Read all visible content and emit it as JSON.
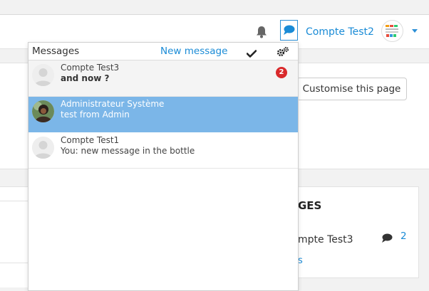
{
  "navbar": {
    "user_name": "Compte Test2",
    "icons": [
      "bell-icon",
      "chat-icon",
      "chevron-down-icon"
    ],
    "accent_color": "#1a8bd6"
  },
  "page": {
    "customise_label": "Customise this page",
    "messages_block": {
      "title_fragment": "GES",
      "contact_fragment": "mpte Test3",
      "count": "2",
      "link_fragment": "s"
    }
  },
  "popover": {
    "title": "Messages",
    "new_message_label": "New message",
    "icons": [
      "check-icon",
      "gear-icon"
    ],
    "messages": [
      {
        "name": "Compte Test3",
        "text": "and now ?",
        "unread": "2",
        "state": "unread"
      },
      {
        "name": "Administrateur Système",
        "text": "test from Admin",
        "state": "selected"
      },
      {
        "name": "Compte Test1",
        "text": "You: new message in the bottle",
        "state": "read"
      }
    ],
    "badge_color": "#d9292b",
    "selected_color": "#7bb6e8"
  }
}
